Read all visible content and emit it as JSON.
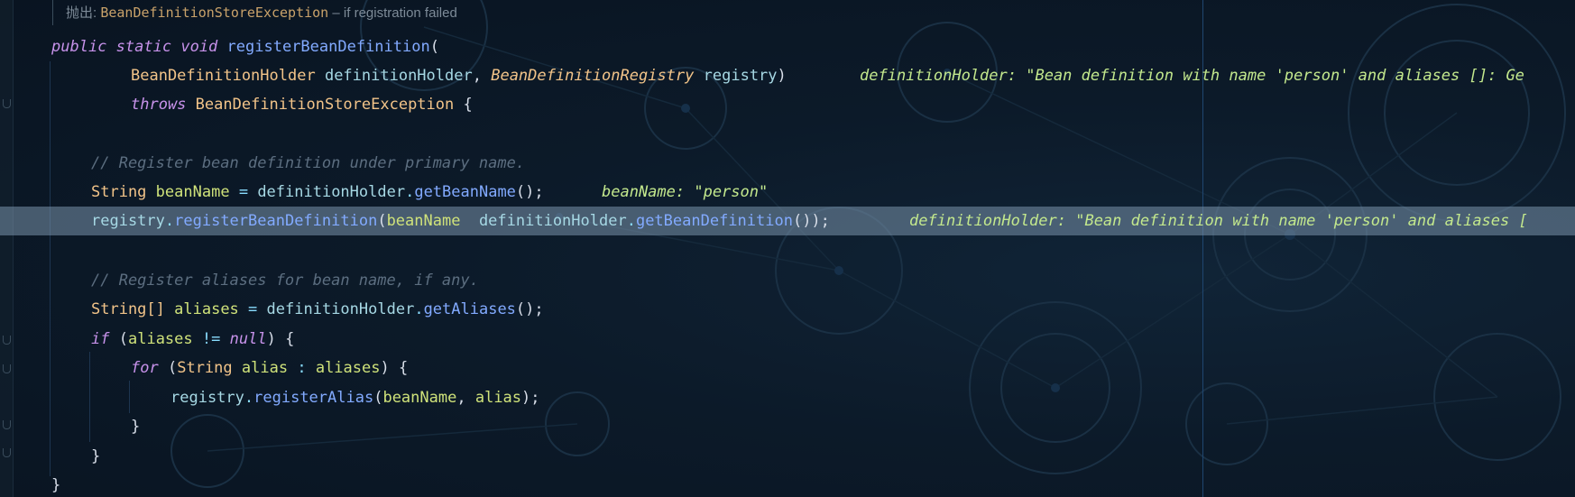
{
  "doc_hint": {
    "prefix": "抛出:",
    "exception": "BeanDefinitionStoreException",
    "description": "– if registration failed"
  },
  "code": {
    "l1": {
      "kw1": "public",
      "kw2": "static",
      "kw3": "void",
      "method": "registerBeanDefinition",
      "paren": "("
    },
    "l2": {
      "type1": "BeanDefinitionHolder",
      "param1": "definitionHolder",
      "comma": ",",
      "type2": "BeanDefinitionRegistry",
      "param2": "registry",
      "close": ")",
      "hint": "definitionHolder: \"Bean definition with name 'person' and aliases []: Ge"
    },
    "l3": {
      "kw": "throws",
      "type": "BeanDefinitionStoreException",
      "brace": "{"
    },
    "l5": {
      "comment": "// Register bean definition under primary name."
    },
    "l6": {
      "type": "String",
      "var": "beanName",
      "eq": "=",
      "obj": "definitionHolder",
      "dot": ".",
      "call": "getBeanName",
      "tail": "();",
      "hint": "beanName: \"person\""
    },
    "l7": {
      "obj": "registry",
      "dot1": ".",
      "call": "registerBeanDefinition",
      "open": "(",
      "arg1": "beanName",
      "arg2": "definitionHolder",
      "dot2": ".",
      "call2": "getBeanDefinition",
      "tail": "());",
      "hint": "definitionHolder: \"Bean definition with name 'person' and aliases ["
    },
    "l9": {
      "comment": "// Register aliases for bean name, if any."
    },
    "l10": {
      "type": "String[]",
      "var": "aliases",
      "eq": "=",
      "obj": "definitionHolder",
      "dot": ".",
      "call": "getAliases",
      "tail": "();"
    },
    "l11": {
      "kw": "if",
      "open": "(",
      "var": "aliases",
      "op": "!=",
      "nul": "null",
      "close": ")",
      "brace": "{"
    },
    "l12": {
      "kw": "for",
      "open": "(",
      "type": "String",
      "var": "alias",
      "colon": ":",
      "iter": "aliases",
      "close": ")",
      "brace": "{"
    },
    "l13": {
      "obj": "registry",
      "dot": ".",
      "call": "registerAlias",
      "open": "(",
      "arg1": "beanName",
      "comma": ",",
      "arg2": "alias",
      "tail": ");"
    },
    "l14": {
      "brace": "}"
    },
    "l15": {
      "brace": "}"
    },
    "l16": {
      "brace": "}"
    }
  },
  "colors": {
    "background": "#0b1724",
    "keyword": "#c792ea",
    "type": "#f2c489",
    "method": "#82aaff",
    "local_var": "#cfe27a",
    "parameter": "#a6d8e4",
    "comment": "#5c6e80",
    "inline_hint": "#c3e88d",
    "current_line": "#5f7891"
  }
}
